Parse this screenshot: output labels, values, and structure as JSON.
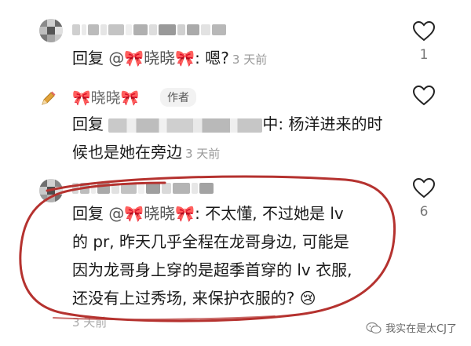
{
  "comments": [
    {
      "reply_prefix": "回复 ",
      "mention_name": "@🎀晓晓🎀",
      "text": ": 嗯?",
      "time": "3 天前",
      "likes": "1"
    },
    {
      "author_name": "🎀晓晓🎀",
      "author_badge": "作者",
      "reply_prefix": "回复 ",
      "text_line1": "中: 杨洋进来的时",
      "text_line2": "候也是她在旁边",
      "time": "3 天前",
      "likes": ""
    },
    {
      "reply_prefix": "回复 ",
      "mention_name": "@🎀晓晓🎀",
      "line1": ": 不太懂, 不过她是 lv",
      "line2": "的 pr, 昨天几乎全程在龙哥身边, 可能是",
      "line3": "因为龙哥身上穿的是超季首穿的 lv 衣服,",
      "line4": "还没有上过秀场, 来保护衣服的?",
      "emoji": "😢",
      "time": "3 天前",
      "likes": "6"
    }
  ],
  "watermark": {
    "text": "我实在是太CJ了"
  },
  "colors": {
    "annotation_circle": "#b5322f",
    "bow": "#e48aa6",
    "time": "#999999"
  }
}
